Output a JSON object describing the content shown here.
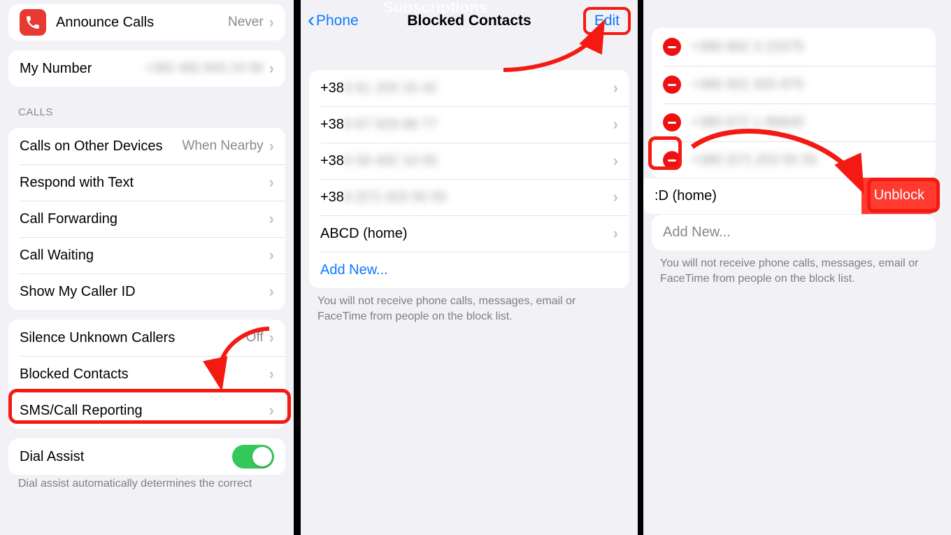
{
  "left": {
    "announce": {
      "label": "Announce Calls",
      "value": "Never"
    },
    "myNumber": {
      "label": "My Number",
      "value": "+382 492 843 24 56"
    },
    "sectionCalls": "CALLS",
    "callsOther": {
      "label": "Calls on Other Devices",
      "value": "When Nearby"
    },
    "respond": {
      "label": "Respond with Text"
    },
    "forwarding": {
      "label": "Call Forwarding"
    },
    "waiting": {
      "label": "Call Waiting"
    },
    "callerid": {
      "label": "Show My Caller ID"
    },
    "silence": {
      "label": "Silence Unknown Callers",
      "value": "Off"
    },
    "blocked": {
      "label": "Blocked Contacts"
    },
    "sms": {
      "label": "SMS/Call Reporting"
    },
    "dial": {
      "label": "Dial Assist"
    },
    "dialNote": "Dial assist automatically determines the correct"
  },
  "mid": {
    "back": "Phone",
    "title": "Blocked Contacts",
    "subs": "Subscriptions",
    "edit": "Edit",
    "rows": [
      {
        "prefix": "+38",
        "rest": "0 61 203 33 42"
      },
      {
        "prefix": "+38",
        "rest": "0 67 929 88 77"
      },
      {
        "prefix": "+38",
        "rest": "0 50 492 10 05"
      },
      {
        "prefix": "+38",
        "rest": "0 (57) 203 55 55"
      }
    ],
    "named": "ABCD (home)",
    "add": "Add New...",
    "note": "You will not receive phone calls, messages, email or FaceTime from people on the block list."
  },
  "right": {
    "rows": [
      "+380 682 3 23375",
      "+380 501 925 875",
      "+380 672 1 86840",
      "+380 (57) 203 55 55"
    ],
    "swipe": ":D (home)",
    "unblock": "Unblock",
    "add": "Add New...",
    "note": "You will not receive phone calls, messages, email or FaceTime from people on the block list."
  }
}
